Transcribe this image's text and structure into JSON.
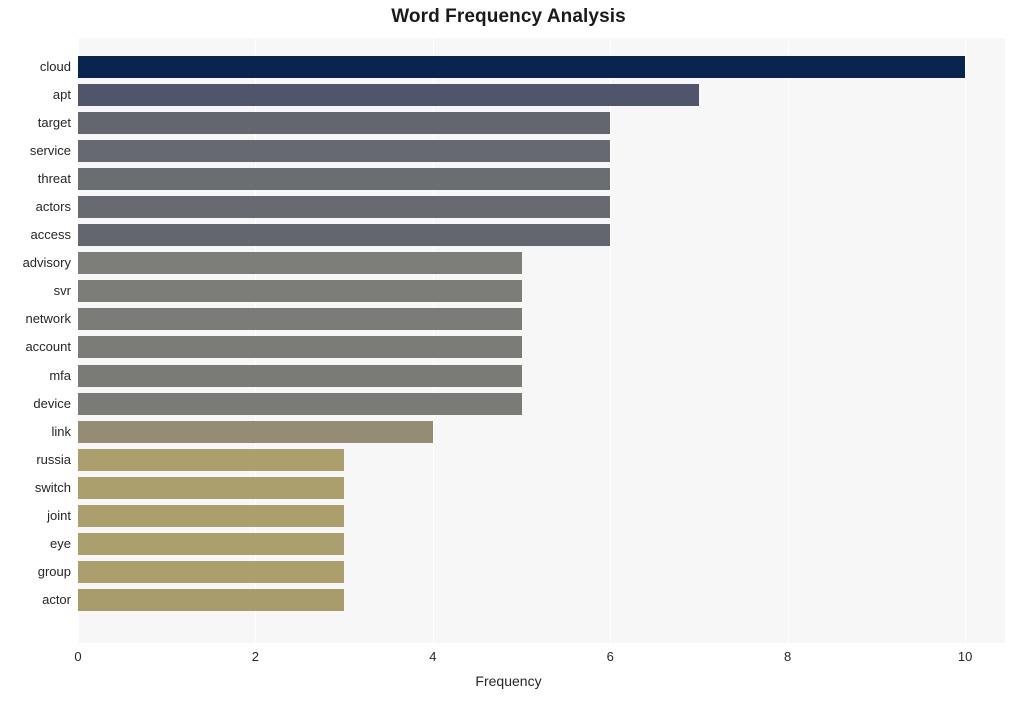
{
  "chart_data": {
    "type": "bar",
    "orientation": "horizontal",
    "title": "Word Frequency Analysis",
    "xlabel": "Frequency",
    "ylabel": "",
    "xlim": [
      0,
      10.45
    ],
    "xticks": [
      0,
      2,
      4,
      6,
      8,
      10
    ],
    "xtick_labels": [
      "0",
      "2",
      "4",
      "6",
      "8",
      "10"
    ],
    "grid": true,
    "grid_axis": "x",
    "legend": "none",
    "categories": [
      "cloud",
      "apt",
      "target",
      "service",
      "threat",
      "actors",
      "access",
      "advisory",
      "svr",
      "network",
      "account",
      "mfa",
      "device",
      "link",
      "russia",
      "switch",
      "joint",
      "eye",
      "group",
      "actor"
    ],
    "values": [
      10,
      7,
      6,
      6,
      6,
      6,
      6,
      5,
      5,
      5,
      5,
      5,
      5,
      4,
      3,
      3,
      3,
      3,
      3,
      3
    ],
    "bar_colors": [
      "#0a2450",
      "#4f566b",
      "#63666e",
      "#666970",
      "#6a6d72",
      "#676a71",
      "#63666e",
      "#7d7d79",
      "#7c7c79",
      "#7b7b78",
      "#7b7b78",
      "#7a7a77",
      "#7a7a77",
      "#948d74",
      "#ab9f6e",
      "#ab9f6e",
      "#ab9f6e",
      "#ab9f6e",
      "#ab9f6e",
      "#a89c6c"
    ],
    "plot_bgcolor": "#f7f7f7",
    "grid_color": "#ffffff",
    "figure_bgcolor": "#ffffff",
    "text_color": "#262626"
  }
}
